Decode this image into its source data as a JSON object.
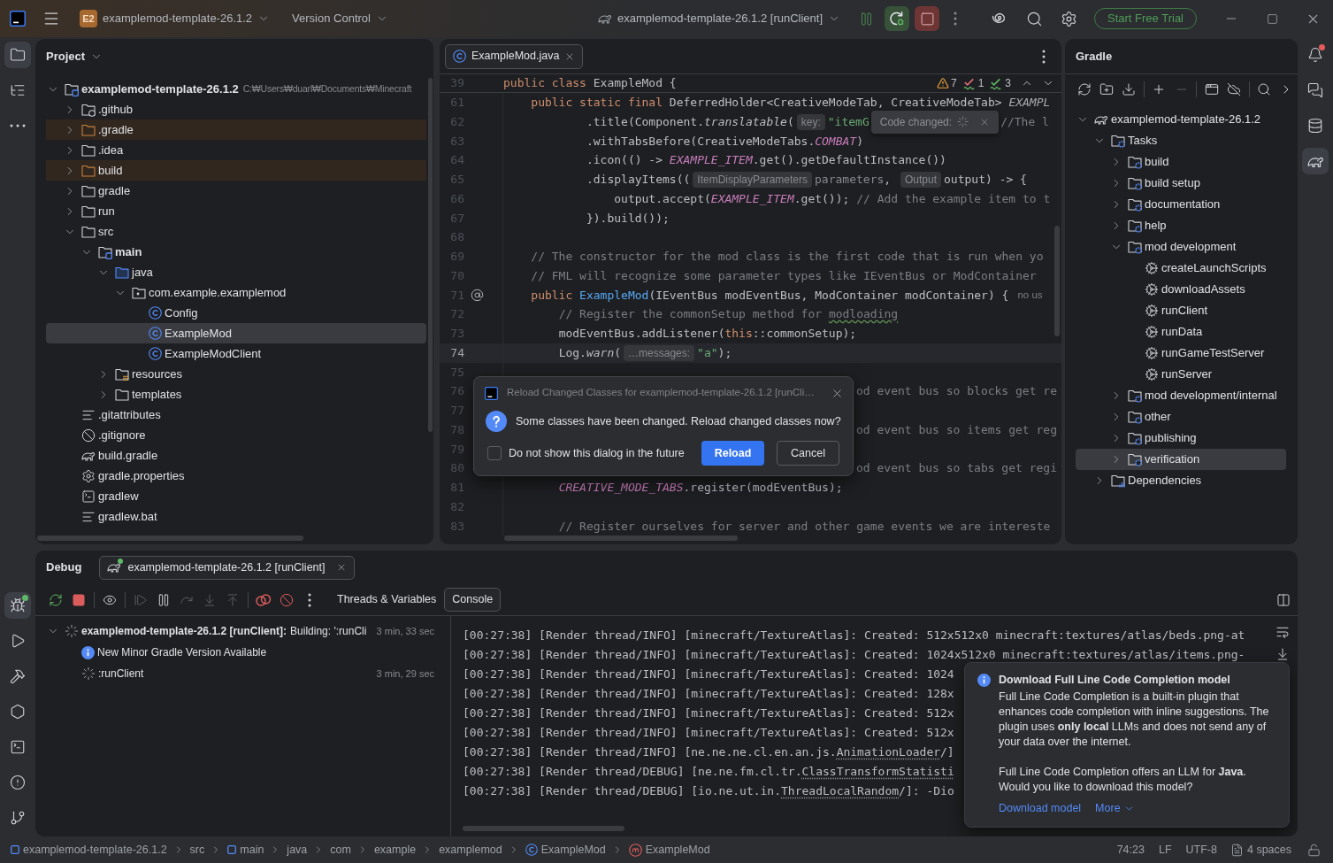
{
  "title_bar": {
    "project_badge": "E2",
    "project_name": "examplemod-template-26.1.2",
    "vcs_menu": "Version Control",
    "run_config": "examplemod-template-26.1.2 [runClient]",
    "run_actions": [
      {
        "kind": "hotswap"
      },
      {
        "kind": "debug"
      },
      {
        "kind": "stop"
      }
    ],
    "trial_button": "Start Free Trial"
  },
  "left_toolbar": {
    "top": [
      {
        "kind": "project",
        "selected": true
      },
      {
        "kind": "structure",
        "selected": false
      },
      {
        "kind": "more",
        "selected": false
      }
    ],
    "bottom": [
      {
        "kind": "debug",
        "selected": true,
        "running": true
      },
      {
        "kind": "run",
        "selected": false,
        "running": false
      },
      {
        "kind": "build",
        "selected": false,
        "running": false
      },
      {
        "kind": "services",
        "selected": false,
        "running": false
      },
      {
        "kind": "terminal",
        "selected": false,
        "running": false
      },
      {
        "kind": "problems",
        "selected": false,
        "running": false
      },
      {
        "kind": "git",
        "selected": false,
        "running": false
      }
    ]
  },
  "project_panel": {
    "title": "Project",
    "tree": [
      {
        "label": "examplemod-template-26.1.2",
        "path": "C:₩Users₩duarl₩Documents₩Minecraft",
        "kind": "module",
        "expanded": true,
        "selected": false,
        "children": [
          {
            "label": ".github",
            "kind": "github_folder",
            "expanded": false,
            "selected": false
          },
          {
            "label": ".gradle",
            "kind": "excluded_folder",
            "expanded": false,
            "selected": false
          },
          {
            "label": ".idea",
            "kind": "folder",
            "expanded": false,
            "selected": false
          },
          {
            "label": "build",
            "kind": "excluded_folder",
            "expanded": false,
            "selected": false
          },
          {
            "label": "gradle",
            "kind": "folder",
            "expanded": false,
            "selected": false
          },
          {
            "label": "run",
            "kind": "folder",
            "expanded": false,
            "selected": false
          },
          {
            "label": "src",
            "kind": "folder",
            "expanded": true,
            "selected": false,
            "children": [
              {
                "label": "main",
                "kind": "module",
                "expanded": true,
                "selected": false,
                "children": [
                  {
                    "label": "java",
                    "kind": "source_root",
                    "expanded": true,
                    "selected": false,
                    "children": [
                      {
                        "label": "com.example.examplemod",
                        "kind": "package",
                        "expanded": true,
                        "selected": false,
                        "children": [
                          {
                            "label": "Config",
                            "kind": "class",
                            "selected": false
                          },
                          {
                            "label": "ExampleMod",
                            "kind": "class",
                            "selected": true
                          },
                          {
                            "label": "ExampleModClient",
                            "kind": "class",
                            "selected": false
                          }
                        ]
                      }
                    ]
                  },
                  {
                    "label": "resources",
                    "kind": "resource_folder",
                    "expanded": false,
                    "selected": false
                  },
                  {
                    "label": "templates",
                    "kind": "folder",
                    "expanded": false,
                    "selected": false
                  }
                ]
              }
            ]
          },
          {
            "label": ".gitattributes",
            "kind": "text_file",
            "selected": false
          },
          {
            "label": ".gitignore",
            "kind": "ignore_file",
            "selected": false
          },
          {
            "label": "build.gradle",
            "kind": "gradle_file",
            "selected": false
          },
          {
            "label": "gradle.properties",
            "kind": "properties_file",
            "selected": false
          },
          {
            "label": "gradlew",
            "kind": "script_file",
            "selected": false
          },
          {
            "label": "gradlew.bat",
            "kind": "text_file",
            "selected": false
          }
        ]
      }
    ]
  },
  "editor": {
    "tabs": [
      {
        "label": "ExampleMod.java",
        "selected": true
      }
    ],
    "sticky_line": {
      "number": "39",
      "tokens": [
        {
          "kind": "keyword",
          "text": "public class "
        },
        {
          "kind": "plain",
          "text": "ExampleMod {"
        }
      ]
    },
    "inspections": [
      {
        "kind": "warning",
        "count": "7"
      },
      {
        "kind": "weak_warning",
        "count": "1"
      },
      {
        "kind": "typo",
        "count": "3"
      }
    ],
    "lines": [
      {
        "number": "61",
        "current": false,
        "covered": false,
        "annotated": false,
        "tokens": [
          {
            "kind": "keyword",
            "text": "    public static final "
          },
          {
            "kind": "plain",
            "text": "DeferredHolder<CreativeModeTab, CreativeModeTab> "
          },
          {
            "kind": "field",
            "text": "EXAMPL"
          }
        ]
      },
      {
        "number": "62",
        "current": false,
        "covered": false,
        "annotated": false,
        "tokens": [
          {
            "kind": "plain",
            "text": "            .title(Component."
          },
          {
            "kind": "italic",
            "text": "translatable"
          },
          {
            "kind": "plain",
            "text": "("
          },
          {
            "kind": "hint",
            "text": "key:"
          },
          {
            "kind": "string",
            "text": "\"itemG"
          },
          {
            "kind": "popup",
            "text": "Code changed:"
          },
          {
            "kind": "comment",
            "text": "//The l"
          }
        ]
      },
      {
        "number": "63",
        "current": false,
        "covered": false,
        "annotated": false,
        "tokens": [
          {
            "kind": "plain",
            "text": "            .withTabsBefore(CreativeModeTabs."
          },
          {
            "kind": "constant",
            "text": "COMBAT"
          },
          {
            "kind": "plain",
            "text": ")"
          }
        ]
      },
      {
        "number": "64",
        "current": false,
        "covered": false,
        "annotated": false,
        "tokens": [
          {
            "kind": "plain",
            "text": "            .icon(() -> "
          },
          {
            "kind": "constant",
            "text": "EXAMPLE_ITEM"
          },
          {
            "kind": "plain",
            "text": ".get().getDefaultInstance())"
          }
        ]
      },
      {
        "number": "65",
        "current": false,
        "covered": false,
        "annotated": false,
        "tokens": [
          {
            "kind": "plain",
            "text": "            .displayItems(("
          },
          {
            "kind": "hint",
            "text": "ItemDisplayParameters"
          },
          {
            "kind": "unused",
            "text": "parameters"
          },
          {
            "kind": "plain",
            "text": ", "
          },
          {
            "kind": "hint",
            "text": "Output"
          },
          {
            "kind": "plain",
            "text": "output) -> {"
          }
        ]
      },
      {
        "number": "66",
        "current": false,
        "covered": false,
        "annotated": false,
        "tokens": [
          {
            "kind": "plain",
            "text": "                output.accept("
          },
          {
            "kind": "constant",
            "text": "EXAMPLE_ITEM"
          },
          {
            "kind": "plain",
            "text": ".get()); "
          },
          {
            "kind": "comment",
            "text": "// Add the example item to t"
          }
        ]
      },
      {
        "number": "67",
        "current": false,
        "covered": false,
        "annotated": false,
        "tokens": [
          {
            "kind": "plain",
            "text": "            }).build());"
          }
        ]
      },
      {
        "number": "68",
        "current": false,
        "annotated": false
      },
      {
        "number": "69",
        "current": false,
        "covered": false,
        "annotated": false,
        "tokens": [
          {
            "kind": "comment",
            "text": "    // The constructor for the mod class is the first code that is run when yo"
          }
        ]
      },
      {
        "number": "70",
        "current": false,
        "covered": false,
        "annotated": false,
        "tokens": [
          {
            "kind": "comment",
            "text": "    // FML will recognize some parameter types like IEventBus or ModContainer"
          }
        ]
      },
      {
        "number": "71",
        "current": false,
        "covered": false,
        "annotated": true,
        "tokens": [
          {
            "kind": "keyword",
            "text": "    public "
          },
          {
            "kind": "declaration",
            "text": "ExampleMod"
          },
          {
            "kind": "plain",
            "text": "(IEventBus modEventBus, ModContainer modContainer) {"
          },
          {
            "kind": "usages",
            "text": "no us"
          }
        ]
      },
      {
        "number": "72",
        "current": false,
        "covered": false,
        "annotated": false,
        "tokens": [
          {
            "kind": "comment",
            "text": "        // Register the commonSetup method for "
          },
          {
            "kind": "typo",
            "text": "modloading"
          }
        ]
      },
      {
        "number": "73",
        "current": false,
        "covered": false,
        "annotated": false,
        "tokens": [
          {
            "kind": "plain",
            "text": "        modEventBus.addListener("
          },
          {
            "kind": "keyword",
            "text": "this"
          },
          {
            "kind": "plain",
            "text": "::commonSetup);"
          }
        ]
      },
      {
        "number": "74",
        "current": true,
        "covered": false,
        "annotated": false,
        "tokens": [
          {
            "kind": "plain",
            "text": "        Log."
          },
          {
            "kind": "italic",
            "text": "warn"
          },
          {
            "kind": "plain",
            "text": "("
          },
          {
            "kind": "hint",
            "text": "…messages:"
          },
          {
            "kind": "string",
            "text": "\"a\""
          },
          {
            "kind": "plain",
            "text": ");"
          }
        ]
      },
      {
        "number": "75",
        "current": false,
        "annotated": false
      },
      {
        "number": "76",
        "current": false,
        "covered": true,
        "annotated": false,
        "tokens": [
          {
            "kind": "comment",
            "text": "od event bus so blocks get re"
          }
        ]
      },
      {
        "number": "77",
        "current": false,
        "annotated": false
      },
      {
        "number": "78",
        "current": false,
        "covered": true,
        "annotated": false,
        "tokens": [
          {
            "kind": "comment",
            "text": "od event bus so items get reg"
          }
        ]
      },
      {
        "number": "79",
        "current": false,
        "annotated": false
      },
      {
        "number": "80",
        "current": false,
        "covered": true,
        "annotated": false,
        "tokens": [
          {
            "kind": "comment",
            "text": "od event bus so tabs get regi"
          }
        ]
      },
      {
        "number": "81",
        "current": false,
        "covered": false,
        "annotated": false,
        "tokens": [
          {
            "kind": "constant",
            "text": "        CREATIVE_MODE_TABS"
          },
          {
            "kind": "plain",
            "text": ".register(modEventBus);"
          }
        ]
      },
      {
        "number": "82",
        "current": false,
        "annotated": false
      },
      {
        "number": "83",
        "current": false,
        "covered": false,
        "annotated": false,
        "tokens": [
          {
            "kind": "comment",
            "text": "        // Register ourselves for server and other game events we are intereste"
          }
        ]
      }
    ]
  },
  "reload_dialog": {
    "title": "Reload Changed Classes for examplemod-template-26.1.2 [runCli…",
    "message": "Some classes have been changed. Reload changed classes now?",
    "checkbox": {
      "label": "Do not show this dialog in the future",
      "checked": false
    },
    "buttons": [
      {
        "label": "Reload",
        "kind": "primary"
      },
      {
        "label": "Cancel",
        "kind": "secondary"
      }
    ]
  },
  "gradle_panel": {
    "title": "Gradle",
    "toolbar": [
      [
        {
          "kind": "refresh",
          "disabled": false
        },
        {
          "kind": "link",
          "disabled": false
        },
        {
          "kind": "download",
          "disabled": false
        }
      ],
      [
        {
          "kind": "add",
          "disabled": false
        },
        {
          "kind": "remove",
          "disabled": true
        }
      ],
      [
        {
          "kind": "execute",
          "disabled": false
        },
        {
          "kind": "offline",
          "disabled": false
        }
      ],
      [
        {
          "kind": "analyze",
          "disabled": false
        },
        {
          "kind": "more",
          "disabled": false
        }
      ]
    ],
    "tree": [
      {
        "label": "examplemod-template-26.1.2",
        "kind": "gradle_project",
        "expanded": true,
        "selected": false,
        "children": [
          {
            "label": "Tasks",
            "kind": "task_folder",
            "expanded": true,
            "selected": false,
            "children": [
              {
                "label": "build",
                "kind": "task_group",
                "expanded": false,
                "selected": false
              },
              {
                "label": "build setup",
                "kind": "task_group",
                "expanded": false,
                "selected": false
              },
              {
                "label": "documentation",
                "kind": "task_group",
                "expanded": false,
                "selected": false
              },
              {
                "label": "help",
                "kind": "task_group",
                "expanded": false,
                "selected": false
              },
              {
                "label": "mod development",
                "kind": "task_group",
                "expanded": true,
                "selected": false,
                "children": [
                  {
                    "label": "createLaunchScripts",
                    "kind": "task",
                    "selected": false
                  },
                  {
                    "label": "downloadAssets",
                    "kind": "task",
                    "selected": false
                  },
                  {
                    "label": "runClient",
                    "kind": "task",
                    "selected": false
                  },
                  {
                    "label": "runData",
                    "kind": "task",
                    "selected": false
                  },
                  {
                    "label": "runGameTestServer",
                    "kind": "task",
                    "selected": false
                  },
                  {
                    "label": "runServer",
                    "kind": "task",
                    "selected": false
                  }
                ]
              },
              {
                "label": "mod development/internal",
                "kind": "task_group",
                "expanded": false,
                "selected": false
              },
              {
                "label": "other",
                "kind": "task_group",
                "expanded": false,
                "selected": false
              },
              {
                "label": "publishing",
                "kind": "task_group",
                "expanded": false,
                "selected": false
              },
              {
                "label": "verification",
                "kind": "task_group",
                "expanded": false,
                "selected": true
              }
            ]
          },
          {
            "label": "Dependencies",
            "kind": "dependencies",
            "expanded": false,
            "selected": false
          }
        ]
      }
    ]
  },
  "right_toolbar": [
    {
      "kind": "notifications",
      "selected": false,
      "unread": true
    },
    {
      "kind": "ai_chat",
      "selected": false,
      "unread": false
    },
    {
      "kind": "database",
      "selected": false,
      "unread": false
    },
    {
      "kind": "gradle",
      "selected": true,
      "unread": false
    }
  ],
  "debug_panel": {
    "title": "Debug",
    "sessions": [
      {
        "label": "examplemod-template-26.1.2 [runClient]",
        "selected": true,
        "running": true
      }
    ],
    "toolbar": [
      [
        {
          "kind": "rerun",
          "disabled": false
        },
        {
          "kind": "stop",
          "disabled": false
        }
      ],
      [
        {
          "kind": "watches",
          "disabled": false
        }
      ],
      [
        {
          "kind": "resume",
          "disabled": true
        },
        {
          "kind": "pause",
          "disabled": false
        },
        {
          "kind": "step_over",
          "disabled": true
        },
        {
          "kind": "step_into",
          "disabled": true
        },
        {
          "kind": "step_out",
          "disabled": true
        }
      ],
      [
        {
          "kind": "breakpoints",
          "disabled": false
        },
        {
          "kind": "mute_breakpoints",
          "disabled": false
        },
        {
          "kind": "more",
          "disabled": false
        }
      ]
    ],
    "content_tabs": [
      {
        "label": "Threads & Variables",
        "selected": false
      },
      {
        "label": "Console",
        "selected": true
      }
    ],
    "tree": [
      {
        "label": "examplemod-template-26.1.2 [runClient]:",
        "detail": "Building: ':runCli",
        "time": "3 min, 33 sec",
        "kind": "running",
        "expanded": true,
        "children": [
          {
            "label": "New Minor Gradle Version Available",
            "kind": "info"
          },
          {
            "label": ":runClient",
            "time": "3 min, 29 sec",
            "kind": "running"
          }
        ]
      }
    ],
    "console": [
      {
        "tokens": [
          {
            "kind": "plain",
            "text": "[00:27:38] [Render thread/INFO] [minecraft/TextureAtlas]: Created: 512x512x0 minecraft:textures/atlas/beds.png-at"
          }
        ]
      },
      {
        "tokens": [
          {
            "kind": "plain",
            "text": "[00:27:38] [Render thread/INFO] [minecraft/TextureAtlas]: Created: 1024x512x0 minecraft:textures/atlas/items.png-"
          }
        ]
      },
      {
        "tokens": [
          {
            "kind": "plain",
            "text": "[00:27:38] [Render thread/INFO] [minecraft/TextureAtlas]: Created: 1024"
          }
        ]
      },
      {
        "tokens": [
          {
            "kind": "plain",
            "text": "[00:27:38] [Render thread/INFO] [minecraft/TextureAtlas]: Created: 128x"
          }
        ]
      },
      {
        "tokens": [
          {
            "kind": "plain",
            "text": "[00:27:38] [Render thread/INFO] [minecraft/TextureAtlas]: Created: 512x"
          }
        ]
      },
      {
        "tokens": [
          {
            "kind": "plain",
            "text": "[00:27:38] [Render thread/INFO] [minecraft/TextureAtlas]: Created: 512x"
          }
        ]
      },
      {
        "tokens": [
          {
            "kind": "plain",
            "text": "[00:27:38] [Render thread/INFO] [ne.ne.ne.cl.en.an.js."
          },
          {
            "kind": "link",
            "text": "AnimationLoader"
          },
          {
            "kind": "plain",
            "text": "/]"
          }
        ]
      },
      {
        "tokens": [
          {
            "kind": "plain",
            "text": "[00:27:38] [Render thread/DEBUG] [ne.ne.fm.cl.tr."
          },
          {
            "kind": "link",
            "text": "ClassTransformStatisti"
          }
        ]
      },
      {
        "tokens": [
          {
            "kind": "plain",
            "text": "[00:27:38] [Render thread/DEBUG] [io.ne.ut.in."
          },
          {
            "kind": "link",
            "text": "ThreadLocalRandom"
          },
          {
            "kind": "plain",
            "text": "/]: -Dio"
          }
        ]
      }
    ]
  },
  "notification": {
    "title": "Download Full Line Code Completion model",
    "paragraphs": [
      "Full Line Code Completion is a built-in plugin that enhances code completion with inline suggestions. The plugin uses **only local** LLMs and does not send any of your data over the internet.",
      "Full Line Code Completion offers an LLM for **Java**. Would you like to download this model?"
    ],
    "actions": [
      {
        "label": "Download model",
        "kind": "link"
      },
      {
        "label": "More",
        "kind": "dropdown"
      }
    ]
  },
  "status_bar": {
    "breadcrumbs": [
      {
        "label": "examplemod-template-26.1.2",
        "kind": "module"
      },
      {
        "label": "src",
        "kind": "plain"
      },
      {
        "label": "main",
        "kind": "module"
      },
      {
        "label": "java",
        "kind": "plain"
      },
      {
        "label": "com",
        "kind": "plain"
      },
      {
        "label": "example",
        "kind": "plain"
      },
      {
        "label": "examplemod",
        "kind": "plain"
      },
      {
        "label": "ExampleMod",
        "kind": "class"
      },
      {
        "label": "ExampleMod",
        "kind": "method"
      }
    ],
    "caret": "74:23",
    "line_separator": "LF",
    "encoding": "UTF-8",
    "indent": "4 spaces"
  }
}
